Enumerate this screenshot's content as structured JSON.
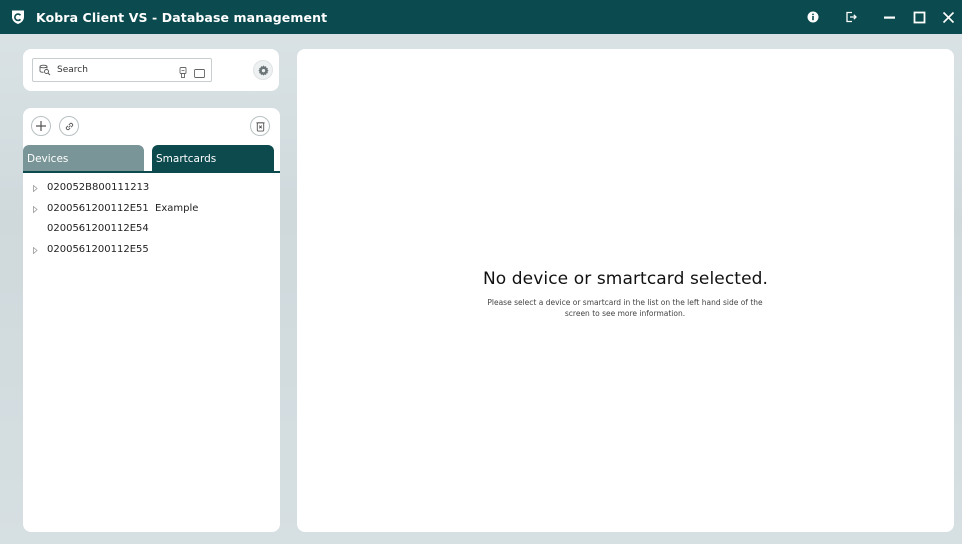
{
  "window": {
    "title": "Kobra Client VS - Database management",
    "accent": "#0b4a4e",
    "controls": [
      "info-icon",
      "logout-icon",
      "minimize-icon",
      "maximize-icon",
      "close-icon"
    ]
  },
  "search": {
    "placeholder": "Search",
    "value": ""
  },
  "tabs": {
    "devices_label": "Devices",
    "smartcards_label": "Smartcards",
    "active": "Smartcards"
  },
  "tree": {
    "items": [
      {
        "id": "020052B800111213",
        "note": "",
        "expandable": true
      },
      {
        "id": "0200561200112E51",
        "note": "Example",
        "expandable": true
      },
      {
        "id": "0200561200112E54",
        "note": "",
        "expandable": false
      },
      {
        "id": "0200561200112E55",
        "note": "",
        "expandable": true
      }
    ]
  },
  "main": {
    "empty_title": "No device or smartcard selected.",
    "empty_description": "Please select a device or smartcard in the list on the left hand side of the screen to see more information."
  }
}
